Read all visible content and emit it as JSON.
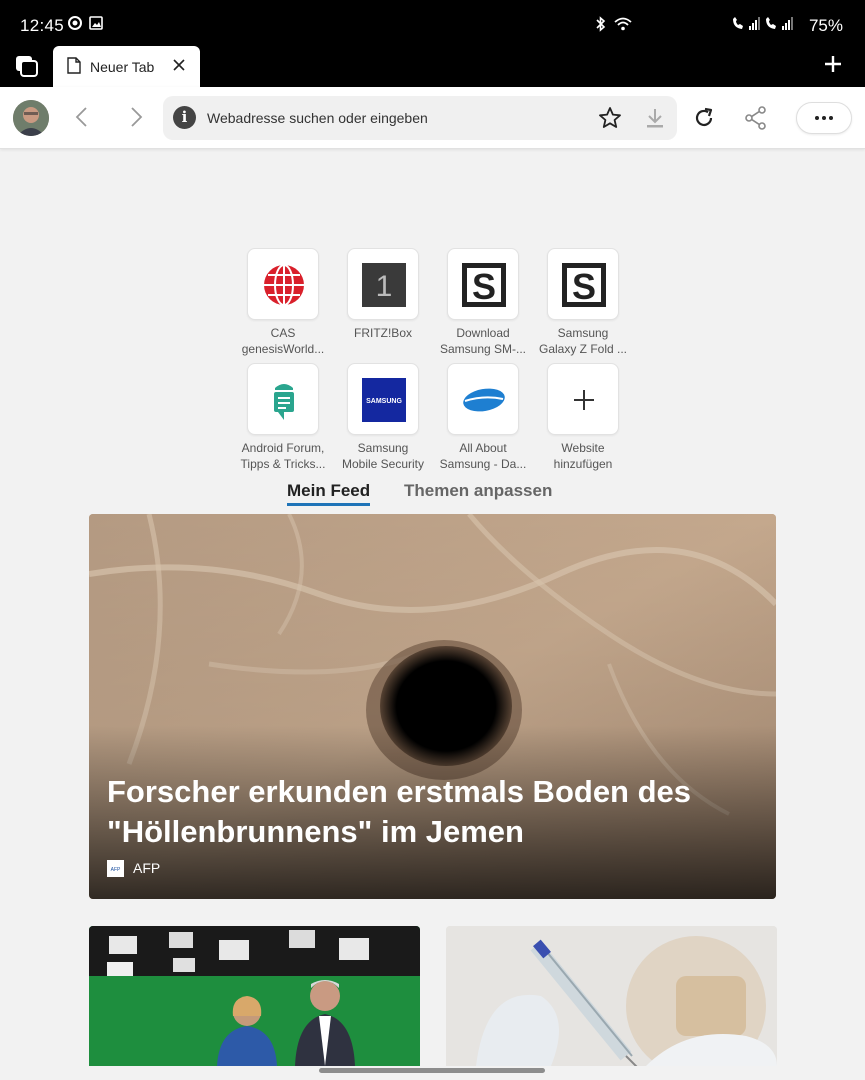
{
  "status_bar": {
    "time": "12:45",
    "battery": "75%"
  },
  "tab": {
    "title": "Neuer Tab"
  },
  "toolbar": {
    "address_placeholder": "Webadresse suchen oder eingeben"
  },
  "speed_dial": [
    {
      "label": "CAS\ngenesisWorld...",
      "icon": "cas-globe-icon"
    },
    {
      "label": "FRITZ!Box",
      "icon": "fritzbox-icon",
      "glyph": "1"
    },
    {
      "label": "Download\nSamsung SM-...",
      "icon": "s-logo-icon",
      "glyph": "S"
    },
    {
      "label": "Samsung\nGalaxy Z Fold ...",
      "icon": "s-logo-icon",
      "glyph": "S"
    },
    {
      "label": "Android Forum,\nTipps & Tricks...",
      "icon": "android-forum-icon"
    },
    {
      "label": "Samsung\nMobile Security",
      "icon": "samsung-logo-icon",
      "glyph": "SAMSUNG"
    },
    {
      "label": "All About\nSamsung - Da...",
      "icon": "samsung-ellipse-icon"
    },
    {
      "label": "Website\nhinzufügen",
      "icon": "plus-icon"
    }
  ],
  "feed_tabs": {
    "active": "Mein Feed",
    "other": "Themen anpassen"
  },
  "hero_article": {
    "title": "Forscher erkunden erstmals Boden des \"Höllenbrunnens\" im Jemen",
    "source": "AFP"
  },
  "colors": {
    "accent": "#1f74b8",
    "status_bar_bg": "#000000",
    "page_bg": "#f2f2f2"
  }
}
